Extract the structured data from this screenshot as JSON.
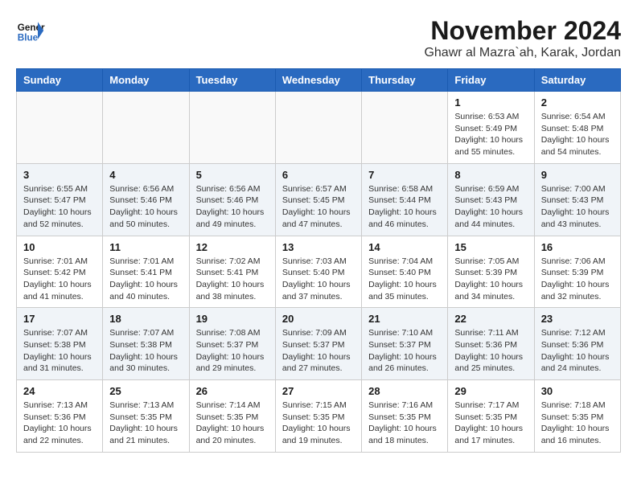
{
  "header": {
    "logo_line1": "General",
    "logo_line2": "Blue",
    "month": "November 2024",
    "location": "Ghawr al Mazra`ah, Karak, Jordan"
  },
  "days_of_week": [
    "Sunday",
    "Monday",
    "Tuesday",
    "Wednesday",
    "Thursday",
    "Friday",
    "Saturday"
  ],
  "rows": [
    {
      "alt": false,
      "cells": [
        {
          "day": "",
          "info": ""
        },
        {
          "day": "",
          "info": ""
        },
        {
          "day": "",
          "info": ""
        },
        {
          "day": "",
          "info": ""
        },
        {
          "day": "",
          "info": ""
        },
        {
          "day": "1",
          "info": "Sunrise: 6:53 AM\nSunset: 5:49 PM\nDaylight: 10 hours\nand 55 minutes."
        },
        {
          "day": "2",
          "info": "Sunrise: 6:54 AM\nSunset: 5:48 PM\nDaylight: 10 hours\nand 54 minutes."
        }
      ]
    },
    {
      "alt": true,
      "cells": [
        {
          "day": "3",
          "info": "Sunrise: 6:55 AM\nSunset: 5:47 PM\nDaylight: 10 hours\nand 52 minutes."
        },
        {
          "day": "4",
          "info": "Sunrise: 6:56 AM\nSunset: 5:46 PM\nDaylight: 10 hours\nand 50 minutes."
        },
        {
          "day": "5",
          "info": "Sunrise: 6:56 AM\nSunset: 5:46 PM\nDaylight: 10 hours\nand 49 minutes."
        },
        {
          "day": "6",
          "info": "Sunrise: 6:57 AM\nSunset: 5:45 PM\nDaylight: 10 hours\nand 47 minutes."
        },
        {
          "day": "7",
          "info": "Sunrise: 6:58 AM\nSunset: 5:44 PM\nDaylight: 10 hours\nand 46 minutes."
        },
        {
          "day": "8",
          "info": "Sunrise: 6:59 AM\nSunset: 5:43 PM\nDaylight: 10 hours\nand 44 minutes."
        },
        {
          "day": "9",
          "info": "Sunrise: 7:00 AM\nSunset: 5:43 PM\nDaylight: 10 hours\nand 43 minutes."
        }
      ]
    },
    {
      "alt": false,
      "cells": [
        {
          "day": "10",
          "info": "Sunrise: 7:01 AM\nSunset: 5:42 PM\nDaylight: 10 hours\nand 41 minutes."
        },
        {
          "day": "11",
          "info": "Sunrise: 7:01 AM\nSunset: 5:41 PM\nDaylight: 10 hours\nand 40 minutes."
        },
        {
          "day": "12",
          "info": "Sunrise: 7:02 AM\nSunset: 5:41 PM\nDaylight: 10 hours\nand 38 minutes."
        },
        {
          "day": "13",
          "info": "Sunrise: 7:03 AM\nSunset: 5:40 PM\nDaylight: 10 hours\nand 37 minutes."
        },
        {
          "day": "14",
          "info": "Sunrise: 7:04 AM\nSunset: 5:40 PM\nDaylight: 10 hours\nand 35 minutes."
        },
        {
          "day": "15",
          "info": "Sunrise: 7:05 AM\nSunset: 5:39 PM\nDaylight: 10 hours\nand 34 minutes."
        },
        {
          "day": "16",
          "info": "Sunrise: 7:06 AM\nSunset: 5:39 PM\nDaylight: 10 hours\nand 32 minutes."
        }
      ]
    },
    {
      "alt": true,
      "cells": [
        {
          "day": "17",
          "info": "Sunrise: 7:07 AM\nSunset: 5:38 PM\nDaylight: 10 hours\nand 31 minutes."
        },
        {
          "day": "18",
          "info": "Sunrise: 7:07 AM\nSunset: 5:38 PM\nDaylight: 10 hours\nand 30 minutes."
        },
        {
          "day": "19",
          "info": "Sunrise: 7:08 AM\nSunset: 5:37 PM\nDaylight: 10 hours\nand 29 minutes."
        },
        {
          "day": "20",
          "info": "Sunrise: 7:09 AM\nSunset: 5:37 PM\nDaylight: 10 hours\nand 27 minutes."
        },
        {
          "day": "21",
          "info": "Sunrise: 7:10 AM\nSunset: 5:37 PM\nDaylight: 10 hours\nand 26 minutes."
        },
        {
          "day": "22",
          "info": "Sunrise: 7:11 AM\nSunset: 5:36 PM\nDaylight: 10 hours\nand 25 minutes."
        },
        {
          "day": "23",
          "info": "Sunrise: 7:12 AM\nSunset: 5:36 PM\nDaylight: 10 hours\nand 24 minutes."
        }
      ]
    },
    {
      "alt": false,
      "cells": [
        {
          "day": "24",
          "info": "Sunrise: 7:13 AM\nSunset: 5:36 PM\nDaylight: 10 hours\nand 22 minutes."
        },
        {
          "day": "25",
          "info": "Sunrise: 7:13 AM\nSunset: 5:35 PM\nDaylight: 10 hours\nand 21 minutes."
        },
        {
          "day": "26",
          "info": "Sunrise: 7:14 AM\nSunset: 5:35 PM\nDaylight: 10 hours\nand 20 minutes."
        },
        {
          "day": "27",
          "info": "Sunrise: 7:15 AM\nSunset: 5:35 PM\nDaylight: 10 hours\nand 19 minutes."
        },
        {
          "day": "28",
          "info": "Sunrise: 7:16 AM\nSunset: 5:35 PM\nDaylight: 10 hours\nand 18 minutes."
        },
        {
          "day": "29",
          "info": "Sunrise: 7:17 AM\nSunset: 5:35 PM\nDaylight: 10 hours\nand 17 minutes."
        },
        {
          "day": "30",
          "info": "Sunrise: 7:18 AM\nSunset: 5:35 PM\nDaylight: 10 hours\nand 16 minutes."
        }
      ]
    }
  ]
}
